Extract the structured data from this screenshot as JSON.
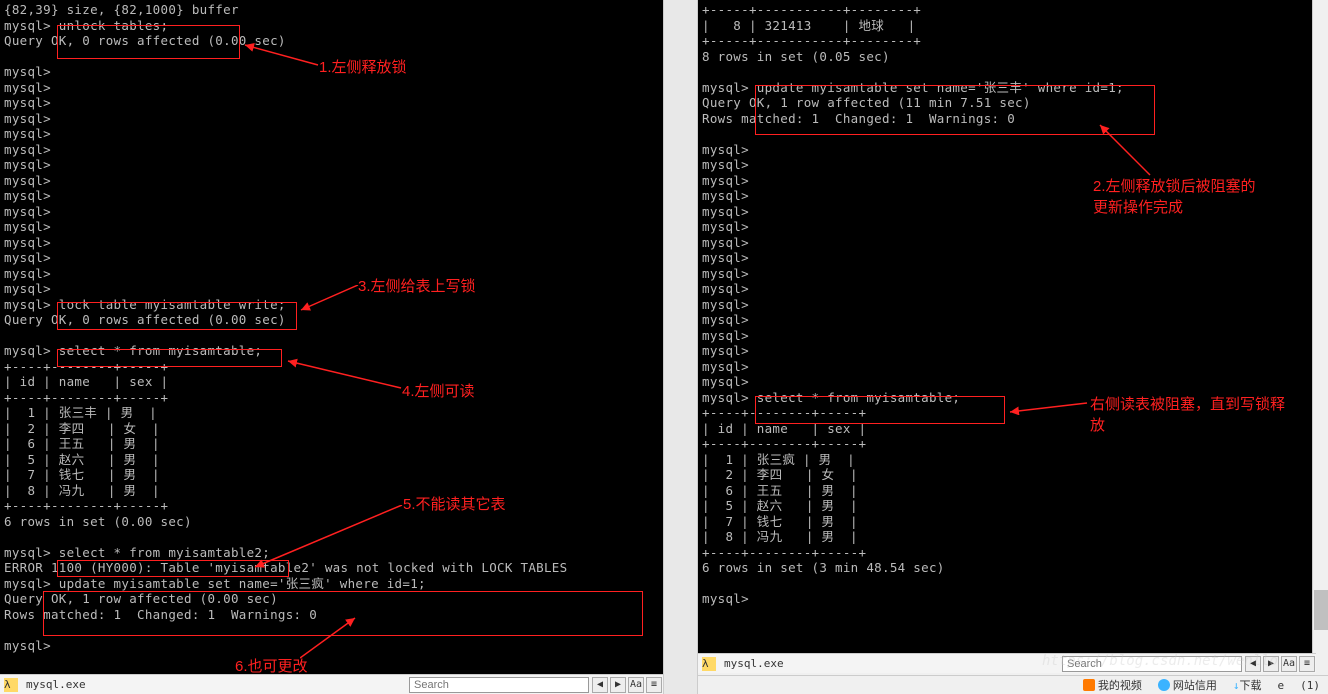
{
  "left_terminal": {
    "content": "{82,39} size, {82,1000} buffer\nmysql> unlock tables;\nQuery OK, 0 rows affected (0.00 sec)\n\nmysql>\nmysql>\nmysql>\nmysql>\nmysql>\nmysql>\nmysql>\nmysql>\nmysql>\nmysql>\nmysql>\nmysql>\nmysql>\nmysql>\nmysql>\nmysql> lock table myisamtable write;\nQuery OK, 0 rows affected (0.00 sec)\n\nmysql> select * from myisamtable;\n+----+--------+-----+\n| id | name   | sex |\n+----+--------+-----+\n|  1 | 张三丰 | 男  |\n|  2 | 李四   | 女  |\n|  6 | 王五   | 男  |\n|  5 | 赵六   | 男  |\n|  7 | 钱七   | 男  |\n|  8 | 冯九   | 男  |\n+----+--------+-----+\n6 rows in set (0.00 sec)\n\nmysql> select * from myisamtable2;\nERROR 1100 (HY000): Table 'myisamtable2' was not locked with LOCK TABLES\nmysql> update myisamtable set name='张三疯' where id=1;\nQuery OK, 1 row affected (0.00 sec)\nRows matched: 1  Changed: 1  Warnings: 0\n\nmysql>"
  },
  "right_terminal": {
    "content": "+-----+-----------+--------+\n|   8 | 321413    | 地球   |\n+-----+-----------+--------+\n8 rows in set (0.05 sec)\n\nmysql> update myisamtable set name='张三丰' where id=1;\nQuery OK, 1 row affected (11 min 7.51 sec)\nRows matched: 1  Changed: 1  Warnings: 0\n\nmysql>\nmysql>\nmysql>\nmysql>\nmysql>\nmysql>\nmysql>\nmysql>\nmysql>\nmysql>\nmysql>\nmysql>\nmysql>\nmysql>\nmysql>\nmysql>\nmysql> select * from myisamtable;\n+----+--------+-----+\n| id | name   | sex |\n+----+--------+-----+\n|  1 | 张三疯 | 男  |\n|  2 | 李四   | 女  |\n|  6 | 王五   | 男  |\n|  5 | 赵六   | 男  |\n|  7 | 钱七   | 男  |\n|  8 | 冯九   | 男  |\n+----+--------+-----+\n6 rows in set (3 min 48.54 sec)\n\nmysql> "
  },
  "annotations": {
    "a1": "1.左侧释放锁",
    "a2": "2.左侧释放锁后被阻塞的\n更新操作完成",
    "a3": "3.左侧给表上写锁",
    "a4": "4.左侧可读",
    "a5": "5.不能读其它表",
    "a6": "6.也可更改",
    "a7": "右侧读表被阻塞，直到写锁释\n放"
  },
  "statusbar": {
    "title_left": "mysql.exe",
    "title_right": "mysql.exe",
    "search_placeholder": "Search"
  },
  "taskbar": {
    "video": "我的视频",
    "site": "网站信用",
    "download": "下载",
    "ie": "e",
    "speaker": "(1)"
  },
  "colors": {
    "annotation": "#ff2020",
    "terminal_bg": "#000000",
    "terminal_fg": "#bbbbbb"
  },
  "watermark": "https://blog.csdn.net/wenllo"
}
